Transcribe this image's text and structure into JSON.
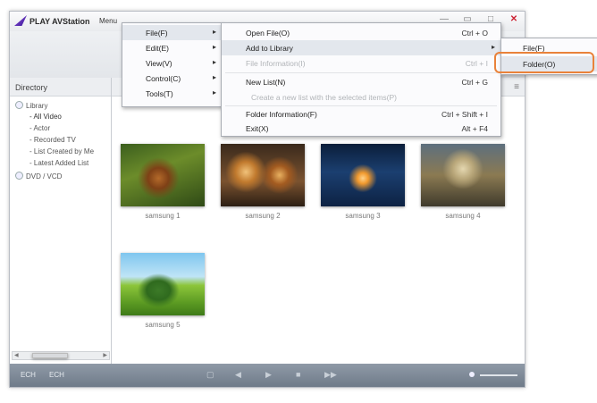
{
  "app": {
    "title": "PLAY AVStation",
    "menu_label": "Menu",
    "window_controls": [
      "—",
      "▭",
      "□",
      "✕"
    ]
  },
  "sidebar": {
    "header": "Directory",
    "tree": [
      {
        "label": "Library",
        "level": 0
      },
      {
        "label": "- All Video",
        "level": 1
      },
      {
        "label": "- Actor",
        "level": 1
      },
      {
        "label": "- Recorded TV",
        "level": 1
      },
      {
        "label": "- List Created by Me",
        "level": 1
      },
      {
        "label": "- Latest Added List",
        "level": 1
      },
      {
        "label": "DVD / VCD",
        "level": 0
      }
    ]
  },
  "content": {
    "header_icon": "≡",
    "thumbnails": [
      {
        "label": "samsung 1"
      },
      {
        "label": "samsung 2"
      },
      {
        "label": "samsung 3"
      },
      {
        "label": "samsung 4"
      },
      {
        "label": "samsung 5"
      }
    ]
  },
  "bottom_bar": {
    "left_buttons": [
      "ECH",
      "ECH"
    ],
    "controls": [
      "▢",
      "◀",
      "▶",
      "■",
      "▶▶"
    ]
  },
  "menu_main": {
    "items": [
      {
        "label": "File(F)"
      },
      {
        "label": "Edit(E)"
      },
      {
        "label": "View(V)"
      },
      {
        "label": "Control(C)"
      },
      {
        "label": "Tools(T)"
      }
    ],
    "arrow": "▸"
  },
  "menu_file": {
    "items": [
      {
        "label": "Open File(O)",
        "shortcut": "Ctrl + O"
      },
      {
        "label": "Add to Library",
        "shortcut": ""
      },
      {
        "label": "File Information(I)",
        "shortcut": "Ctrl + I"
      },
      {
        "label": "New List(N)",
        "shortcut": "Ctrl + G"
      },
      {
        "label": "Create a new list with the selected items(P)",
        "shortcut": ""
      },
      {
        "label": "Folder Information(F)",
        "shortcut": "Ctrl + Shift + I"
      },
      {
        "label": "Exit(X)",
        "shortcut": "Alt + F4"
      }
    ],
    "arrow": "▸"
  },
  "menu_library": {
    "items": [
      {
        "label": "File(F)"
      },
      {
        "label": "Folder(O)"
      }
    ],
    "highlight_color": "#e9823a"
  }
}
